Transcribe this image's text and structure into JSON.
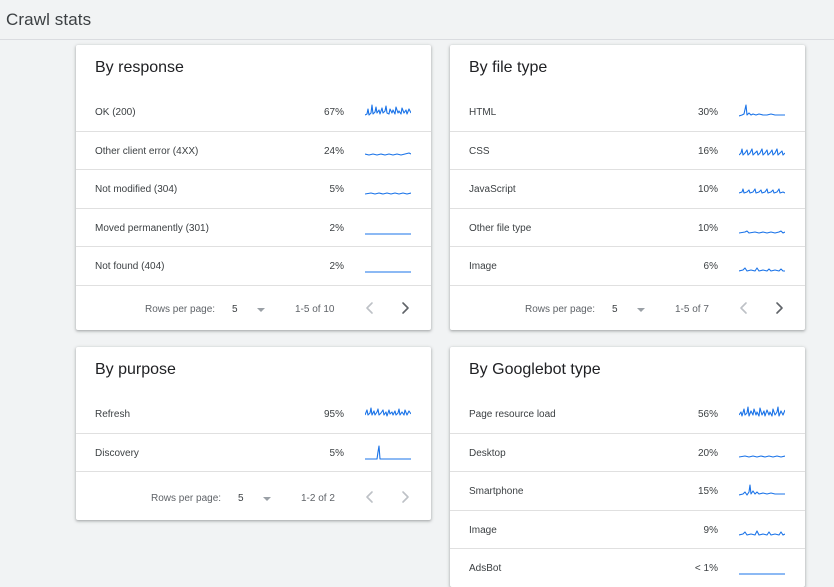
{
  "page": {
    "title": "Crawl stats"
  },
  "colors": {
    "accent": "#1a73e8",
    "background": "#f1f3f4"
  },
  "cards": {
    "response": {
      "title": "By response",
      "rows": [
        {
          "label": "OK (200)",
          "value": "67%"
        },
        {
          "label": "Other client error (4XX)",
          "value": "24%"
        },
        {
          "label": "Not modified (304)",
          "value": "5%"
        },
        {
          "label": "Moved permanently (301)",
          "value": "2%"
        },
        {
          "label": "Not found (404)",
          "value": "2%"
        }
      ],
      "pager": {
        "rows_per_page_label": "Rows per page:",
        "rows_per_page": "5",
        "range": "1-5 of 10"
      }
    },
    "filetype": {
      "title": "By file type",
      "rows": [
        {
          "label": "HTML",
          "value": "30%"
        },
        {
          "label": "CSS",
          "value": "16%"
        },
        {
          "label": "JavaScript",
          "value": "10%"
        },
        {
          "label": "Other file type",
          "value": "10%"
        },
        {
          "label": "Image",
          "value": "6%"
        }
      ],
      "pager": {
        "rows_per_page_label": "Rows per page:",
        "rows_per_page": "5",
        "range": "1-5 of 7"
      }
    },
    "purpose": {
      "title": "By purpose",
      "rows": [
        {
          "label": "Refresh",
          "value": "95%"
        },
        {
          "label": "Discovery",
          "value": "5%"
        }
      ],
      "pager": {
        "rows_per_page_label": "Rows per page:",
        "rows_per_page": "5",
        "range": "1-2 of 2"
      }
    },
    "googlebot": {
      "title": "By Googlebot type",
      "rows": [
        {
          "label": "Page resource load",
          "value": "56%"
        },
        {
          "label": "Desktop",
          "value": "20%"
        },
        {
          "label": "Smartphone",
          "value": "15%"
        },
        {
          "label": "Image",
          "value": "9%"
        },
        {
          "label": "AdsBot",
          "value": "< 1%"
        }
      ]
    }
  }
}
